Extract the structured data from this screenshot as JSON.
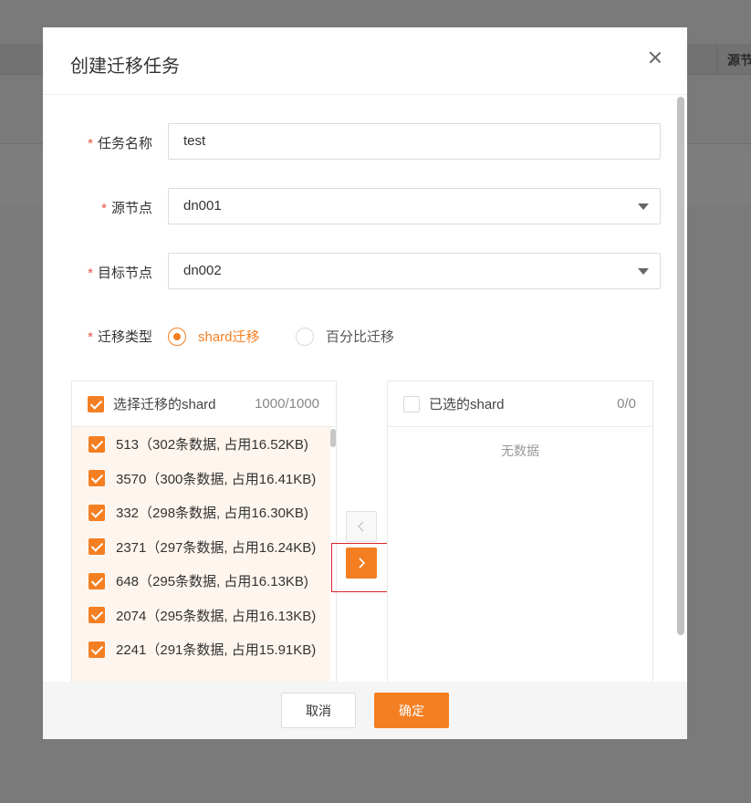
{
  "background": {
    "column_header": "源节"
  },
  "modal": {
    "title": "创建迁移任务",
    "close_icon": "close-icon",
    "form": {
      "required_mark": "*",
      "task_name": {
        "label": "任务名称",
        "value": "test"
      },
      "source_node": {
        "label": "源节点",
        "value": "dn001"
      },
      "target_node": {
        "label": "目标节点",
        "value": "dn002"
      },
      "migration_type": {
        "label": "迁移类型",
        "options": [
          {
            "label": "shard迁移",
            "checked": true
          },
          {
            "label": "百分比迁移",
            "checked": false
          }
        ]
      }
    },
    "transfer": {
      "left": {
        "title": "选择迁移的shard",
        "count": "1000/1000",
        "items": [
          {
            "label": "513（302条数据, 占用16.52KB)",
            "checked": true
          },
          {
            "label": "3570（300条数据, 占用16.41KB)",
            "checked": true
          },
          {
            "label": "332（298条数据, 占用16.30KB)",
            "checked": true
          },
          {
            "label": "2371（297条数据, 占用16.24KB)",
            "checked": true
          },
          {
            "label": "648（295条数据, 占用16.13KB)",
            "checked": true
          },
          {
            "label": "2074（295条数据, 占用16.13KB)",
            "checked": true
          },
          {
            "label": "2241（291条数据, 占用15.91KB)",
            "checked": true
          }
        ]
      },
      "right": {
        "title": "已选的shard",
        "count": "0/0",
        "empty_text": "无数据"
      },
      "move_left_icon": "chevron-left-icon",
      "move_right_icon": "chevron-right-icon"
    },
    "footer": {
      "cancel_label": "取消",
      "ok_label": "确定"
    }
  },
  "colors": {
    "accent": "#f47f22",
    "highlight": "#d9262c",
    "required": "#e5533d"
  }
}
